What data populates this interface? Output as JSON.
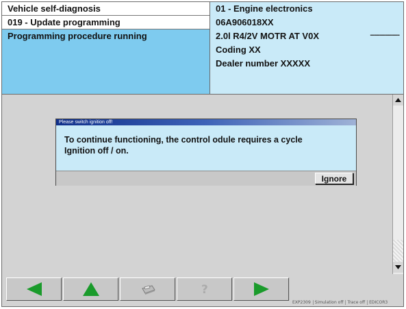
{
  "header": {
    "left_rows": [
      "Vehicle self-diagnosis",
      "019 - Update programming",
      "Programming procedure running"
    ],
    "info": {
      "module": "01 - Engine electronics",
      "part_number": "06A906018XX",
      "dashes": "----------------",
      "engine": "2.0l R4/2V  MOTR AT V0X",
      "coding": "Coding  XX",
      "dealer": "Dealer number  XXXXX"
    }
  },
  "dialog": {
    "title": "Please switch ignition off!",
    "message_line1": "To continue functioning, the control odule requires a cycle",
    "message_line2": "Ignition off / on.",
    "ignore_label": "Ignore"
  },
  "toolbar": {
    "buttons": [
      {
        "icon": "left-arrow-icon",
        "color": "#1a9b2b"
      },
      {
        "icon": "up-arrow-icon",
        "color": "#1a9b2b"
      },
      {
        "icon": "printer-icon",
        "color": "#9a9a9a"
      },
      {
        "icon": "help-icon",
        "color": "#9a9a9a"
      },
      {
        "icon": "right-arrow-icon",
        "color": "#1a9b2b"
      }
    ]
  },
  "scrollbar": {
    "up_icon": "scroll-up-arrow-icon",
    "down_icon": "scroll-down-arrow-icon"
  },
  "statusbar": {
    "items": [
      "EXP2309",
      "Simulation off",
      "Trace off",
      "EDICOR3"
    ]
  },
  "colors": {
    "selected_row": "#7ecbef",
    "info_panel": "#c9eaf8",
    "dialog_bg": "#c9eaf8",
    "arrow_green": "#1a9b2b",
    "title_bar": "#0f2f8a"
  }
}
